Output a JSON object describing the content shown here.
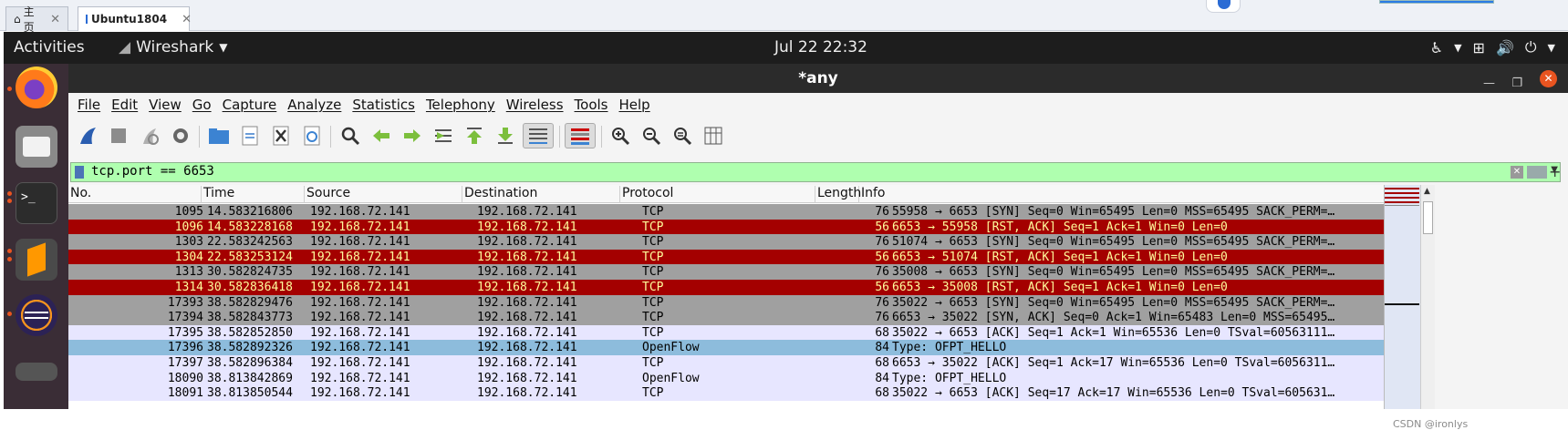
{
  "host_tabs": [
    {
      "label": "主页",
      "icon": "home-icon",
      "active": false
    },
    {
      "label": "Ubuntu1804",
      "icon": "vm-icon",
      "active": true
    }
  ],
  "topbar": {
    "activities": "Activities",
    "app_name": "Wireshark",
    "clock": "Jul 22  22:32"
  },
  "window": {
    "title": "*any"
  },
  "menu": [
    "File",
    "Edit",
    "View",
    "Go",
    "Capture",
    "Analyze",
    "Statistics",
    "Telephony",
    "Wireless",
    "Tools",
    "Help"
  ],
  "filter": {
    "value": "tcp.port == 6653"
  },
  "columns": [
    "No.",
    "Time",
    "Source",
    "Destination",
    "Protocol",
    "Length",
    "Info"
  ],
  "colors": {
    "gray_row": "#a0a0a0",
    "red_row": "#a40000",
    "red_text": "#fffc9c",
    "lav_row": "#e7e6ff",
    "openflow_row": "#8dbcdc",
    "filter_bg": "#afffaf"
  },
  "rows": [
    {
      "no": "1095",
      "time": "14.583216806",
      "src": "192.168.72.141",
      "dst": "192.168.72.141",
      "proto": "TCP",
      "len": "76",
      "info": "55958 → 6653 [SYN] Seq=0 Win=65495 Len=0 MSS=65495 SACK_PERM=…",
      "style": "gray"
    },
    {
      "no": "1096",
      "time": "14.583228168",
      "src": "192.168.72.141",
      "dst": "192.168.72.141",
      "proto": "TCP",
      "len": "56",
      "info": "6653 → 55958 [RST, ACK] Seq=1 Ack=1 Win=0 Len=0",
      "style": "red"
    },
    {
      "no": "1303",
      "time": "22.583242563",
      "src": "192.168.72.141",
      "dst": "192.168.72.141",
      "proto": "TCP",
      "len": "76",
      "info": "51074 → 6653 [SYN] Seq=0 Win=65495 Len=0 MSS=65495 SACK_PERM=…",
      "style": "gray"
    },
    {
      "no": "1304",
      "time": "22.583253124",
      "src": "192.168.72.141",
      "dst": "192.168.72.141",
      "proto": "TCP",
      "len": "56",
      "info": "6653 → 51074 [RST, ACK] Seq=1 Ack=1 Win=0 Len=0",
      "style": "red"
    },
    {
      "no": "1313",
      "time": "30.582824735",
      "src": "192.168.72.141",
      "dst": "192.168.72.141",
      "proto": "TCP",
      "len": "76",
      "info": "35008 → 6653 [SYN] Seq=0 Win=65495 Len=0 MSS=65495 SACK_PERM=…",
      "style": "gray"
    },
    {
      "no": "1314",
      "time": "30.582836418",
      "src": "192.168.72.141",
      "dst": "192.168.72.141",
      "proto": "TCP",
      "len": "56",
      "info": "6653 → 35008 [RST, ACK] Seq=1 Ack=1 Win=0 Len=0",
      "style": "red"
    },
    {
      "no": "17393",
      "time": "38.582829476",
      "src": "192.168.72.141",
      "dst": "192.168.72.141",
      "proto": "TCP",
      "len": "76",
      "info": "35022 → 6653 [SYN] Seq=0 Win=65495 Len=0 MSS=65495 SACK_PERM=…",
      "style": "gray"
    },
    {
      "no": "17394",
      "time": "38.582843773",
      "src": "192.168.72.141",
      "dst": "192.168.72.141",
      "proto": "TCP",
      "len": "76",
      "info": "6653 → 35022 [SYN, ACK] Seq=0 Ack=1 Win=65483 Len=0 MSS=65495…",
      "style": "gray"
    },
    {
      "no": "17395",
      "time": "38.582852850",
      "src": "192.168.72.141",
      "dst": "192.168.72.141",
      "proto": "TCP",
      "len": "68",
      "info": "35022 → 6653 [ACK] Seq=1 Ack=1 Win=65536 Len=0 TSval=60563111…",
      "style": "lav"
    },
    {
      "no": "17396",
      "time": "38.582892326",
      "src": "192.168.72.141",
      "dst": "192.168.72.141",
      "proto": "OpenFlow",
      "len": "84",
      "info": "Type: OFPT_HELLO",
      "style": "openflow"
    },
    {
      "no": "17397",
      "time": "38.582896384",
      "src": "192.168.72.141",
      "dst": "192.168.72.141",
      "proto": "TCP",
      "len": "68",
      "info": "6653 → 35022 [ACK] Seq=1 Ack=17 Win=65536 Len=0 TSval=6056311…",
      "style": "lav"
    },
    {
      "no": "18090",
      "time": "38.813842869",
      "src": "192.168.72.141",
      "dst": "192.168.72.141",
      "proto": "OpenFlow",
      "len": "84",
      "info": "Type: OFPT_HELLO",
      "style": "lav"
    },
    {
      "no": "18091",
      "time": "38.813850544",
      "src": "192.168.72.141",
      "dst": "192.168.72.141",
      "proto": "TCP",
      "len": "68",
      "info": "35022 → 6653 [ACK] Seq=17 Ack=17 Win=65536 Len=0 TSval=605631…",
      "style": "lav"
    }
  ],
  "watermark": "CSDN @ironlys"
}
